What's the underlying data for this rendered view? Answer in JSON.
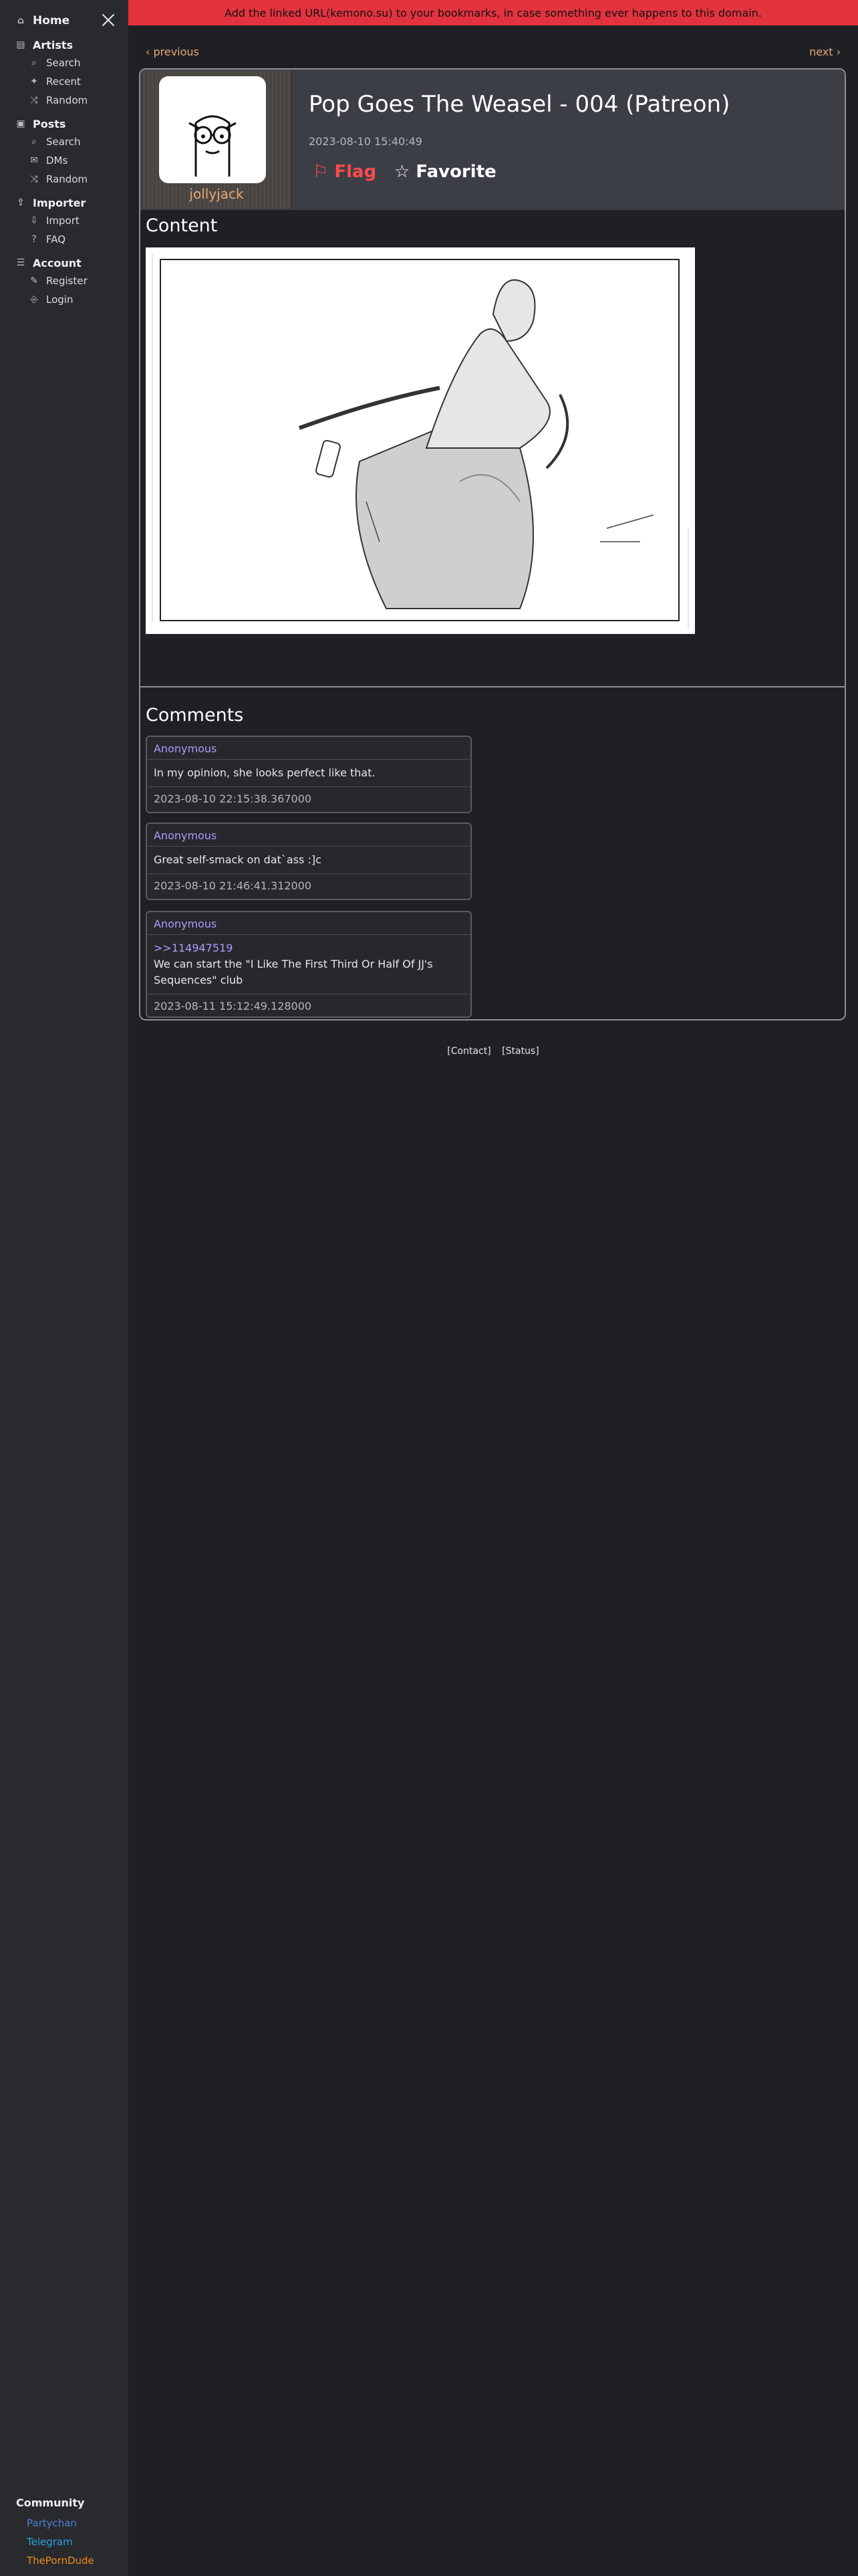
{
  "banner": "Add the linked URL(kemono.su) to your bookmarks, in case something ever happens to this domain.",
  "sidebar": {
    "home": "Home",
    "sections": [
      {
        "title": "Artists",
        "icon": "artists-icon",
        "items": [
          {
            "label": "Search",
            "icon": "search-icon"
          },
          {
            "label": "Recent",
            "icon": "sparkle-icon"
          },
          {
            "label": "Random",
            "icon": "random-icon"
          }
        ]
      },
      {
        "title": "Posts",
        "icon": "posts-icon",
        "items": [
          {
            "label": "Search",
            "icon": "search-icon"
          },
          {
            "label": "DMs",
            "icon": "dm-icon"
          },
          {
            "label": "Random",
            "icon": "random-icon"
          }
        ]
      },
      {
        "title": "Importer",
        "icon": "importer-icon",
        "items": [
          {
            "label": "Import",
            "icon": "import-icon"
          },
          {
            "label": "FAQ",
            "icon": "faq-icon"
          }
        ]
      },
      {
        "title": "Account",
        "icon": "account-icon",
        "items": [
          {
            "label": "Register",
            "icon": "register-icon"
          },
          {
            "label": "Login",
            "icon": "login-icon"
          }
        ]
      }
    ],
    "community": {
      "title": "Community",
      "links": [
        {
          "label": "Partychan",
          "color": "#4f7fd1"
        },
        {
          "label": "Telegram",
          "color": "#2aa3e0"
        },
        {
          "label": "ThePornDude",
          "color": "#f08c1e"
        }
      ]
    }
  },
  "nav": {
    "previous": "‹ previous",
    "next": "next ›"
  },
  "post": {
    "artist": "jollyjack",
    "title": "Pop Goes The Weasel - 004 (Patreon)",
    "published": "2023-08-10 15:40:49",
    "flag_label": "Flag",
    "favorite_label": "Favorite",
    "content_heading": "Content",
    "comments_heading": "Comments"
  },
  "comments": [
    {
      "author": "Anonymous",
      "ref": "",
      "body": "In my opinion, she looks perfect like that.",
      "date": "2023-08-10 22:15:38.367000"
    },
    {
      "author": "Anonymous",
      "ref": "",
      "body": "Great self-smack on dat`ass :]c",
      "date": "2023-08-10 21:46:41.312000"
    },
    {
      "author": "Anonymous",
      "ref": ">>114947519",
      "body": "We can start the \"I Like The First Third Or Half Of JJ's Sequences\" club",
      "date": "2023-08-11 15:12:49.128000"
    }
  ],
  "footer": {
    "contact": "[Contact]",
    "status": "[Status]"
  },
  "colors": {
    "accent": "#e5a776",
    "banner": "#e3333e",
    "comment_author": "#b597ff"
  }
}
